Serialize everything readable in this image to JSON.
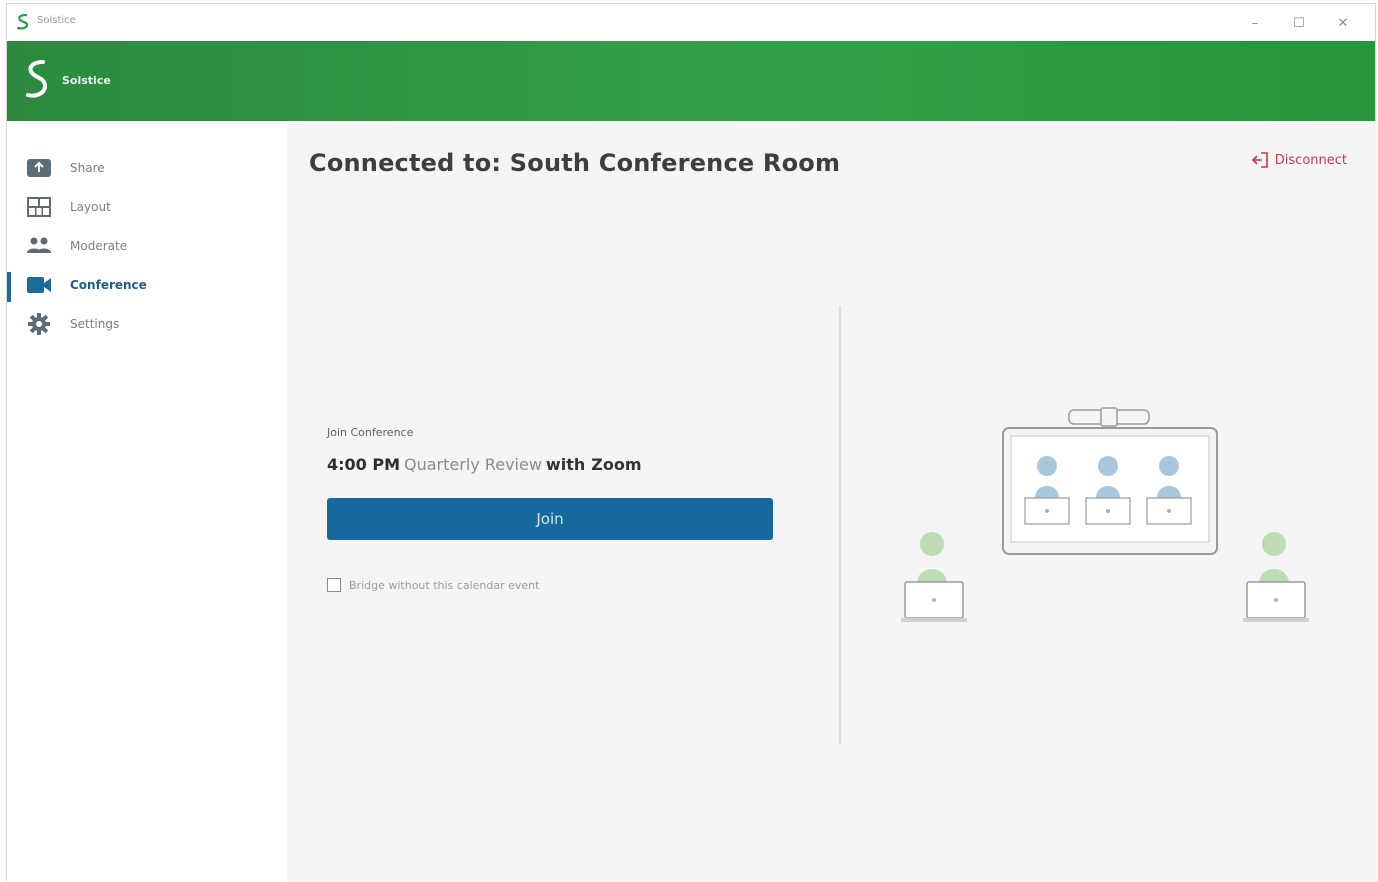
{
  "window": {
    "title": "Solstice",
    "controls": {
      "minimize": "–",
      "maximize": "☐",
      "close": "✕"
    }
  },
  "header": {
    "app_name": "Solstice",
    "color_start": "#2b8a3e",
    "color_end": "#27953a"
  },
  "sidebar": {
    "items": [
      {
        "label": "Share",
        "icon": "share-icon",
        "active": false
      },
      {
        "label": "Layout",
        "icon": "layout-icon",
        "active": false
      },
      {
        "label": "Moderate",
        "icon": "moderate-icon",
        "active": false
      },
      {
        "label": "Conference",
        "icon": "video-camera-icon",
        "active": true
      },
      {
        "label": "Settings",
        "icon": "gear-icon",
        "active": false
      }
    ]
  },
  "main": {
    "title": "Connected to: South Conference Room",
    "disconnect_label": "Disconnect",
    "section_label": "Join Conference",
    "event": {
      "time": "4:00 PM",
      "name": "Quarterly Review",
      "with_word": "with",
      "provider": "Zoom"
    },
    "join_label": "Join",
    "bridge_label": "Bridge without this calendar event",
    "bridge_checked": false
  },
  "colors": {
    "accent": "#15699d",
    "active_nav": "#1d5f8a",
    "disconnect": "#c23a4a"
  }
}
